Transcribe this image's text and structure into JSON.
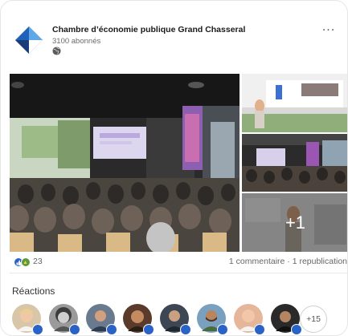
{
  "post": {
    "organization": "Chambre d’économie publique Grand Chasseral",
    "followers": "3100 abonnés",
    "visibility_icon": "globe-icon",
    "menu_icon": "more-icon",
    "more_label": "..."
  },
  "photos": {
    "count_more": "+1"
  },
  "social": {
    "reaction_count": "23",
    "comment_summary": "1 commentaire · 1 republication"
  },
  "reactions": {
    "title": "Réactions",
    "more_label": "+15",
    "avatars": [
      {
        "name": "reactor-1",
        "bg": "#d8c6a8"
      },
      {
        "name": "reactor-2",
        "bg": "#8c8c8c"
      },
      {
        "name": "reactor-3",
        "bg": "#6a7a8e"
      },
      {
        "name": "reactor-4",
        "bg": "#5a3a2a"
      },
      {
        "name": "reactor-5",
        "bg": "#3d4653"
      },
      {
        "name": "reactor-6",
        "bg": "#7aa0c0"
      },
      {
        "name": "reactor-7",
        "bg": "#e6b69a"
      },
      {
        "name": "reactor-8",
        "bg": "#2a2a2a"
      }
    ]
  },
  "colors": {
    "brand_blue": "#1e63b8",
    "brand_dark": "#1a3d7a",
    "like_blue": "#2a63c7",
    "celebrate_green": "#5a9a3c"
  }
}
